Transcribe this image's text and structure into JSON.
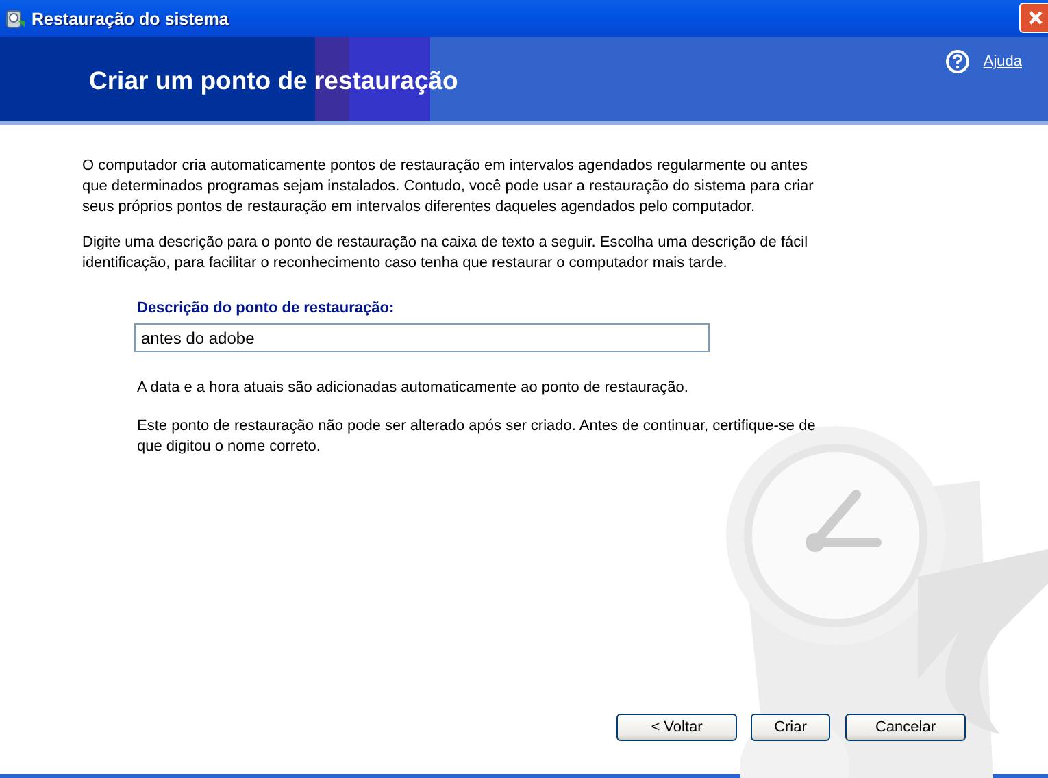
{
  "window": {
    "title": "Restauração do sistema"
  },
  "header": {
    "title": "Criar um ponto de restauração",
    "help_link": "Ajuda"
  },
  "intro_paragraphs": [
    "O computador cria automaticamente pontos de restauração em intervalos agendados regularmente ou antes que determinados programas sejam instalados. Contudo, você pode usar a restauração do sistema para criar seus próprios pontos de restauração em intervalos diferentes daqueles agendados pelo computador.",
    "Digite uma descrição para o ponto de restauração na caixa de texto a seguir. Escolha uma descrição de fácil identificação, para facilitar o reconhecimento caso tenha que restaurar o computador mais tarde."
  ],
  "description_field": {
    "label": "Descrição do ponto de restauração:",
    "value": "antes do adobe"
  },
  "notes": [
    "A data e a hora atuais são adicionadas automaticamente ao ponto de restauração.",
    "Este ponto de restauração não pode ser alterado após ser criado. Antes de continuar, certifique-se de que digitou o nome correto."
  ],
  "buttons": [
    "< Voltar",
    "Criar",
    "Cancelar"
  ]
}
